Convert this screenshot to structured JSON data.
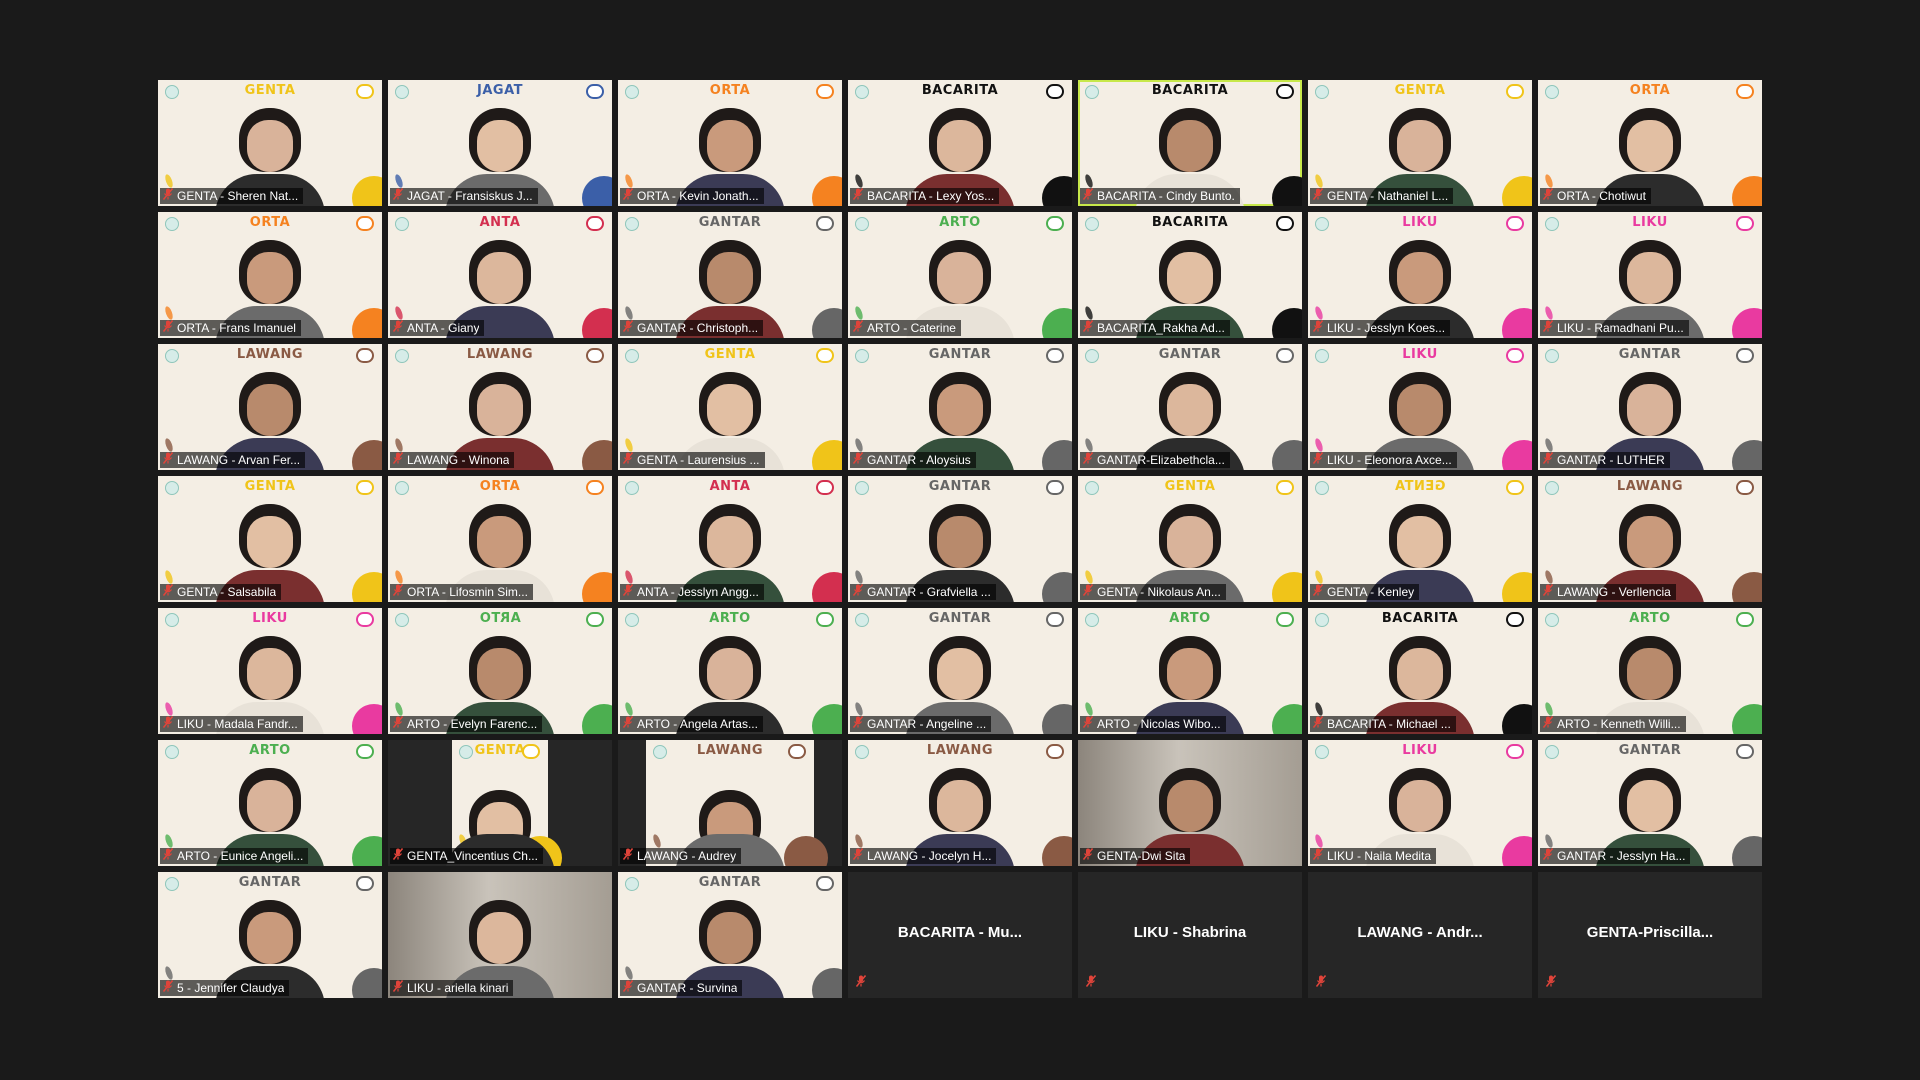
{
  "colors": {
    "background": "#1a1a1a",
    "tile_empty": "#262626",
    "active_speaker_border": "#c7e84a",
    "muted_red": "#e0443a",
    "GENTA": "#f0c419",
    "JAGAT": "#3b5fa8",
    "ORTA": "#f58220",
    "BACARITA": "#111111",
    "ANTA": "#d32f4f",
    "GANTAR": "#666666",
    "ARTO": "#4caf50",
    "LIKU": "#e93aa0",
    "LAWANG": "#8a5a44"
  },
  "participants": [
    {
      "name": "GENTA - Sheren Nat...",
      "house": "GENTA",
      "type": "video"
    },
    {
      "name": "JAGAT - Fransiskus J...",
      "house": "JAGAT",
      "type": "video"
    },
    {
      "name": "ORTA - Kevin Jonath...",
      "house": "ORTA",
      "type": "video"
    },
    {
      "name": "BACARITA - Lexy Yos...",
      "house": "BACARITA",
      "type": "video"
    },
    {
      "name": "BACARITA - Cindy Bunto...",
      "house": "BACARITA",
      "type": "video",
      "active": true
    },
    {
      "name": "GENTA - Nathaniel L...",
      "house": "GENTA",
      "type": "video"
    },
    {
      "name": "ORTA - Chotiwut",
      "house": "ORTA",
      "type": "video"
    },
    {
      "name": "ORTA - Frans Imanuel",
      "house": "ORTA",
      "type": "video"
    },
    {
      "name": "ANTA - Giany",
      "house": "ANTA",
      "type": "video"
    },
    {
      "name": "GANTAR - Christoph...",
      "house": "GANTAR",
      "type": "video"
    },
    {
      "name": "ARTO - Caterine",
      "house": "ARTO",
      "type": "video"
    },
    {
      "name": "BACARITA_Rakha Ad...",
      "house": "BACARITA",
      "type": "video"
    },
    {
      "name": "LIKU - Jesslyn Koes...",
      "house": "LIKU",
      "type": "video"
    },
    {
      "name": "LIKU - Ramadhani Pu...",
      "house": "LIKU",
      "type": "video"
    },
    {
      "name": "LAWANG - Arvan Fer...",
      "house": "LAWANG",
      "type": "video"
    },
    {
      "name": "LAWANG - Winona",
      "house": "LAWANG",
      "type": "video"
    },
    {
      "name": "GENTA - Laurensius ...",
      "house": "GENTA",
      "type": "video"
    },
    {
      "name": "GANTAR - Aloysius",
      "house": "GANTAR",
      "type": "video"
    },
    {
      "name": "GANTAR-Elizabethcla...",
      "house": "GANTAR",
      "type": "video"
    },
    {
      "name": "LIKU - Eleonora Axce...",
      "house": "LIKU",
      "type": "video"
    },
    {
      "name": "GANTAR - LUTHER",
      "house": "GANTAR",
      "type": "video"
    },
    {
      "name": "GENTA - Salsabila",
      "house": "GENTA",
      "type": "video"
    },
    {
      "name": "ORTA - Lifosmin Sim...",
      "house": "ORTA",
      "type": "video"
    },
    {
      "name": "ANTA - Jesslyn Angg...",
      "house": "ANTA",
      "type": "video"
    },
    {
      "name": "GANTAR - Grafviella ...",
      "house": "GANTAR",
      "type": "video"
    },
    {
      "name": "GENTA - Nikolaus An...",
      "house": "GENTA",
      "type": "video"
    },
    {
      "name": "GENTA - Kenley",
      "house": "GENTA",
      "type": "video",
      "mirrored": true
    },
    {
      "name": "LAWANG - Verllencia",
      "house": "LAWANG",
      "type": "video"
    },
    {
      "name": "LIKU - Madala Fandr...",
      "house": "LIKU",
      "type": "video"
    },
    {
      "name": "ARTO - Evelyn Farenc...",
      "house": "ARTO",
      "type": "video",
      "mirrored": true
    },
    {
      "name": "ARTO - Angela Artas...",
      "house": "ARTO",
      "type": "video"
    },
    {
      "name": "GANTAR - Angeline ...",
      "house": "GANTAR",
      "type": "video"
    },
    {
      "name": "ARTO - Nicolas Wibo...",
      "house": "ARTO",
      "type": "video"
    },
    {
      "name": "BACARITA - Michael ...",
      "house": "BACARITA",
      "type": "video"
    },
    {
      "name": "ARTO - Kenneth Willi...",
      "house": "ARTO",
      "type": "video"
    },
    {
      "name": "ARTO - Eunice Angeli...",
      "house": "ARTO",
      "type": "video"
    },
    {
      "name": "GENTA_Vincentius Ch...",
      "house": "GENTA",
      "type": "video",
      "narrow": true
    },
    {
      "name": "LAWANG - Audrey",
      "house": "LAWANG",
      "type": "video",
      "narrow": true
    },
    {
      "name": "LAWANG - Jocelyn H...",
      "house": "LAWANG",
      "type": "video"
    },
    {
      "name": "GENTA-Dwi Sita",
      "house": "",
      "type": "camera"
    },
    {
      "name": "LIKU - Naila Medita",
      "house": "LIKU",
      "type": "video"
    },
    {
      "name": "GANTAR - Jesslyn Ha...",
      "house": "GANTAR",
      "type": "video"
    },
    {
      "name": "5 - Jennifer Claudya",
      "house": "GANTAR",
      "type": "video"
    },
    {
      "name": "LIKU - ariella kinari",
      "house": "",
      "type": "camera"
    },
    {
      "name": "GANTAR - Survina",
      "house": "GANTAR",
      "type": "video"
    },
    {
      "name": "BACARITA - Mu...",
      "house": "",
      "type": "novideo"
    },
    {
      "name": "LIKU - Shabrina",
      "house": "",
      "type": "novideo"
    },
    {
      "name": "LAWANG - Andr...",
      "house": "",
      "type": "novideo"
    },
    {
      "name": "GENTA-Priscilla...",
      "house": "",
      "type": "novideo"
    }
  ]
}
